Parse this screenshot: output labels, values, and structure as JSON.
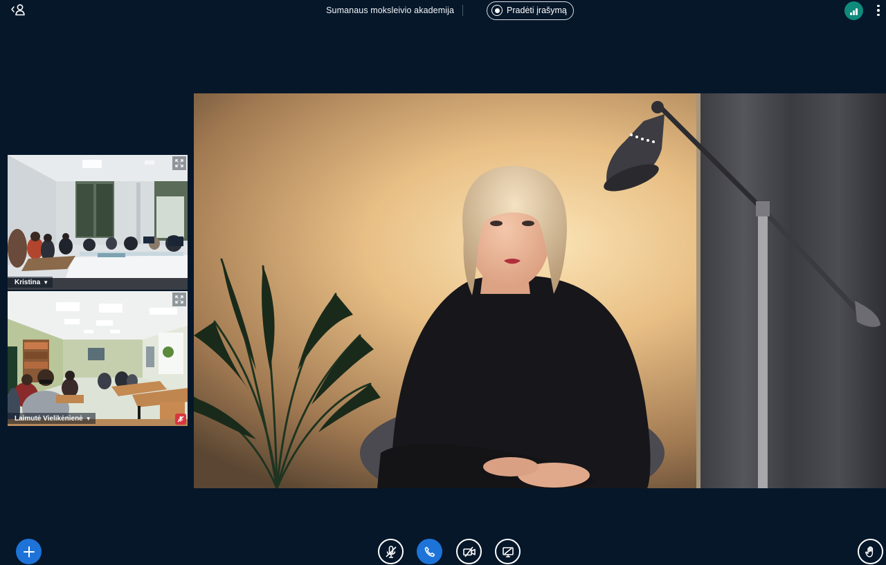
{
  "topbar": {
    "meeting_title": "Sumanaus moksleivio akademija",
    "record_label": "Pradėti įrašymą",
    "icons": {
      "users_toggle": "user-list-icon",
      "record": "record-icon",
      "connection": "signal-bars-icon",
      "options": "vertical-dots-icon"
    }
  },
  "participants": [
    {
      "name": "Kristina",
      "muted": false
    },
    {
      "name": "Laimutė Vielikėnienė",
      "muted": true
    }
  ],
  "controls": {
    "actions": "plus-icon",
    "mic": "microphone-muted-icon",
    "call": "phone-icon",
    "camera": "camera-off-icon",
    "screen_share": "screen-share-off-icon",
    "raise_hand": "raise-hand-icon"
  },
  "colors": {
    "background": "#06172a",
    "accent": "#1d73d8",
    "connection_ok": "#0f8a7b",
    "muted_badge": "#d9363e"
  }
}
